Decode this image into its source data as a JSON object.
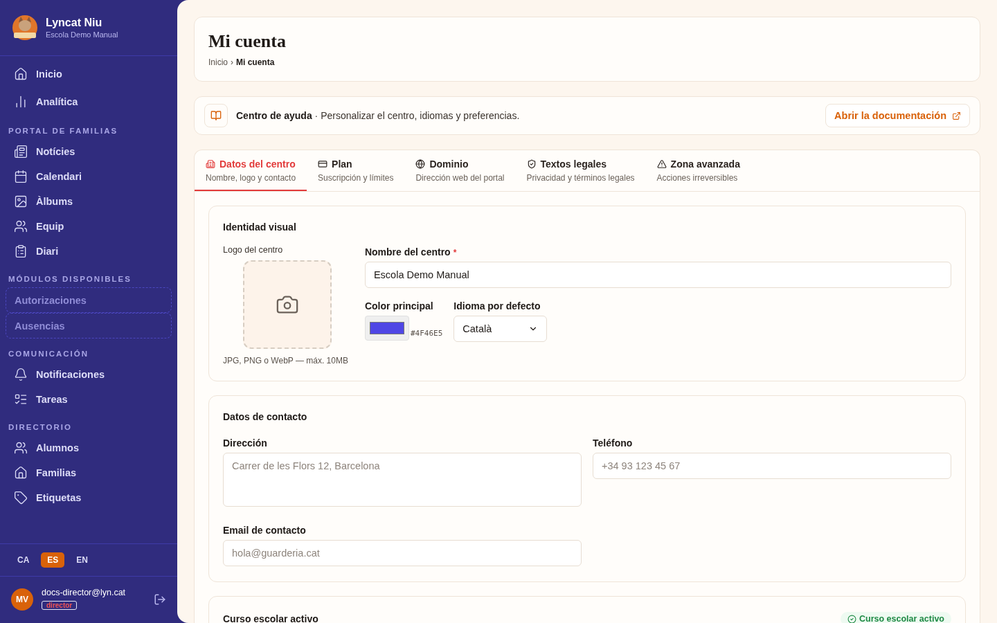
{
  "sidebar": {
    "brand": {
      "name": "Lyncat Niu",
      "subtitle": "Escola Demo Manual"
    },
    "sections": [
      {
        "items": [
          {
            "label": "Inicio",
            "kind": "link"
          },
          {
            "label": "Analítica",
            "kind": "link"
          }
        ]
      },
      {
        "title": "PORTAL DE FAMILIAS",
        "items": [
          {
            "label": "Notícies",
            "kind": "link"
          },
          {
            "label": "Calendari",
            "kind": "link"
          },
          {
            "label": "Àlbums",
            "kind": "link"
          },
          {
            "label": "Equip",
            "kind": "link"
          },
          {
            "label": "Diari",
            "kind": "link"
          }
        ]
      },
      {
        "title": "MÓDULOS DISPONIBLES",
        "items": [
          {
            "label": "Autorizaciones",
            "kind": "module"
          },
          {
            "label": "Ausencias",
            "kind": "module"
          }
        ]
      },
      {
        "title": "COMUNICACIÓN",
        "items": [
          {
            "label": "Notificaciones",
            "kind": "link"
          },
          {
            "label": "Tareas",
            "kind": "link"
          }
        ]
      },
      {
        "title": "DIRECTORIO",
        "items": [
          {
            "label": "Alumnos",
            "kind": "link"
          },
          {
            "label": "Familias",
            "kind": "link"
          },
          {
            "label": "Etiquetas",
            "kind": "link"
          }
        ]
      }
    ],
    "languages": [
      {
        "label": "CA",
        "selected": false
      },
      {
        "label": "ES",
        "selected": true
      },
      {
        "label": "EN",
        "selected": false
      }
    ],
    "user": {
      "initials": "MV",
      "email": "docs-director@lyn.cat",
      "role": "director"
    }
  },
  "header": {
    "title": "Mi cuenta",
    "breadcrumb": [
      {
        "label": "Inicio",
        "current": false
      },
      {
        "label": "Mi cuenta",
        "current": true
      }
    ],
    "separator": "›"
  },
  "help": {
    "text": "**Centro de ayuda** · Personalizar el centro, idiomas y preferencias.",
    "button": "Abrir la documentación"
  },
  "tabs": [
    {
      "label": "Datos del centro",
      "sublabel": "Nombre, logo y contacto",
      "selected": true
    },
    {
      "label": "Plan",
      "sublabel": "Suscripción y límites",
      "selected": false
    },
    {
      "label": "Dominio",
      "sublabel": "Dirección web del portal",
      "selected": false
    },
    {
      "label": "Textos legales",
      "sublabel": "Privacidad y términos legales",
      "selected": false
    },
    {
      "label": "Zona avanzada",
      "sublabel": "Acciones irreversibles",
      "selected": false
    }
  ],
  "identity": {
    "title": "Identidad visual",
    "logo_label": "Logo del centro",
    "logo_hint": "JPG, PNG o WebP — máx. 10MB",
    "name": {
      "label": "Nombre del centro",
      "required": true,
      "required_mark": "*",
      "value": "Escola Demo Manual"
    },
    "color": {
      "label": "Color principal",
      "value": "#4F46E5"
    },
    "language": {
      "label": "Idioma por defecto",
      "value": "Català"
    }
  },
  "contact": {
    "title": "Datos de contacto",
    "address": {
      "label": "Dirección",
      "placeholder": "Carrer de les Flors 12, Barcelona"
    },
    "phone": {
      "label": "Teléfono",
      "placeholder": "+34 93 123 45 67"
    },
    "email": {
      "label": "Email de contacto",
      "placeholder": "hola@guarderia.cat"
    }
  },
  "course": {
    "title": "Curso escolar activo",
    "badge": "Curso escolar activo"
  }
}
